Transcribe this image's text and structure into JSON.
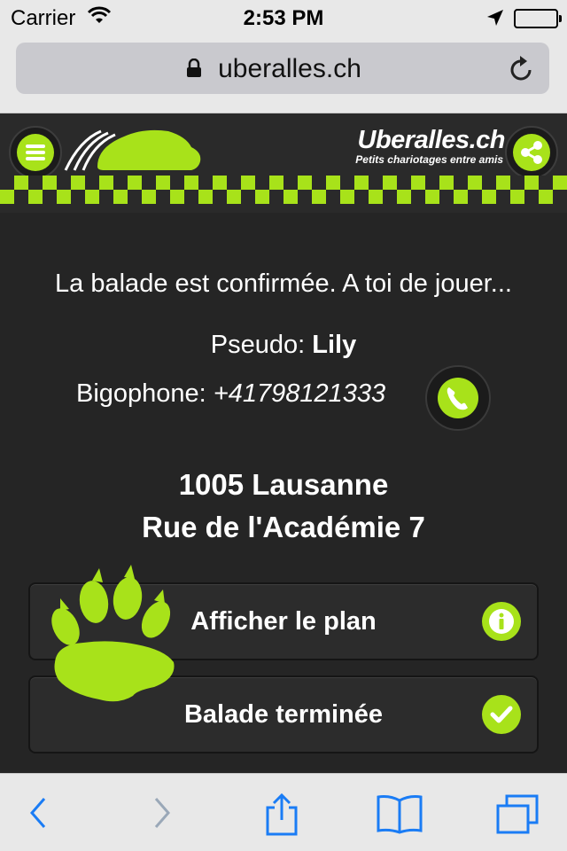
{
  "status_bar": {
    "carrier": "Carrier",
    "time": "2:53 PM"
  },
  "browser": {
    "url": "uberalles.ch"
  },
  "header": {
    "brand": "Uberalles.ch",
    "tagline": "Petits chariotages entre amis"
  },
  "main": {
    "confirmation": "La balade est confirmée. A toi de jouer...",
    "pseudo_label": "Pseudo:",
    "pseudo_value": "Lily",
    "phone_label": "Bigophone:",
    "phone_value": "+41798121333",
    "address_line1": "1005 Lausanne",
    "address_line2": "Rue de l'Académie 7",
    "show_map_label": "Afficher le plan",
    "finish_label": "Balade terminée"
  },
  "colors": {
    "accent": "#a8e21a",
    "background": "#252525"
  },
  "icons": [
    "wifi-icon",
    "location-arrow-icon",
    "battery-icon",
    "lock-icon",
    "reload-icon",
    "menu-icon",
    "car-logo-icon",
    "share-icon",
    "phone-icon",
    "info-icon",
    "checkmark-icon",
    "paw-icon",
    "back-icon",
    "forward-icon",
    "share-upload-icon",
    "bookmarks-icon",
    "tabs-icon"
  ]
}
